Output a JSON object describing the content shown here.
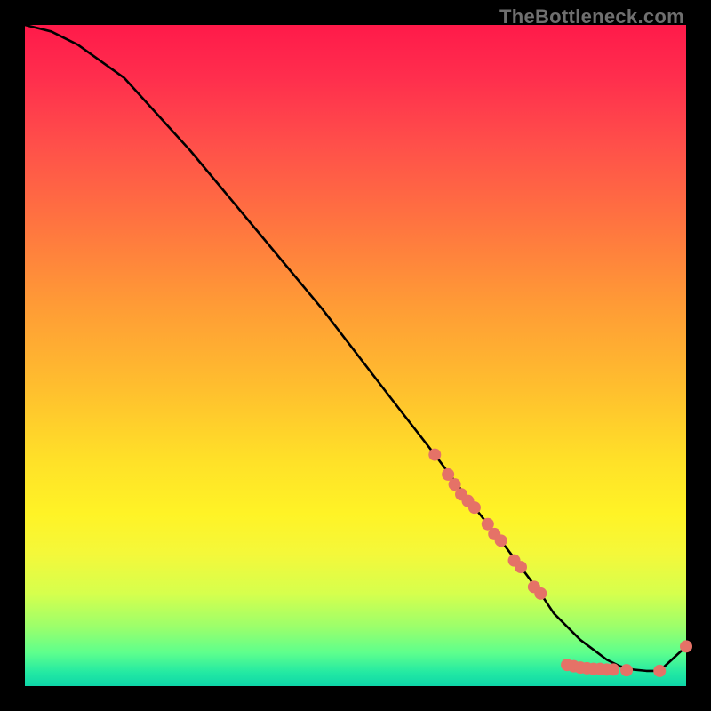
{
  "watermark": "TheBottleneck.com",
  "colors": {
    "background": "#000000",
    "curve": "#000000",
    "marker": "#e57267",
    "watermark": "#6f6f6f"
  },
  "chart_data": {
    "type": "line",
    "title": "",
    "xlabel": "",
    "ylabel": "",
    "xlim": [
      0,
      100
    ],
    "ylim": [
      0,
      100
    ],
    "grid": false,
    "series": [
      {
        "name": "bottleneck-curve",
        "x": [
          0,
          4,
          8,
          15,
          25,
          35,
          45,
          55,
          62,
          68,
          72,
          75,
          78,
          80,
          82,
          84,
          86,
          88,
          90,
          92,
          94,
          96,
          100
        ],
        "y": [
          100,
          99,
          97,
          92,
          81,
          69,
          57,
          44,
          35,
          27,
          22,
          18,
          14,
          11,
          9,
          7,
          5.5,
          4,
          3,
          2.5,
          2.3,
          2.3,
          6
        ]
      }
    ],
    "markers": {
      "name": "highlighted-points",
      "description": "Salmon dots along the lower portion of the curve and the final upturn point",
      "points": [
        {
          "x": 62,
          "y": 35
        },
        {
          "x": 64,
          "y": 32
        },
        {
          "x": 65,
          "y": 30.5
        },
        {
          "x": 66,
          "y": 29
        },
        {
          "x": 67,
          "y": 28
        },
        {
          "x": 68,
          "y": 27
        },
        {
          "x": 70,
          "y": 24.5
        },
        {
          "x": 71,
          "y": 23
        },
        {
          "x": 72,
          "y": 22
        },
        {
          "x": 74,
          "y": 19
        },
        {
          "x": 75,
          "y": 18
        },
        {
          "x": 77,
          "y": 15
        },
        {
          "x": 78,
          "y": 14
        },
        {
          "x": 82,
          "y": 3.2
        },
        {
          "x": 83,
          "y": 3.0
        },
        {
          "x": 84,
          "y": 2.8
        },
        {
          "x": 85,
          "y": 2.7
        },
        {
          "x": 86,
          "y": 2.6
        },
        {
          "x": 87,
          "y": 2.6
        },
        {
          "x": 88,
          "y": 2.5
        },
        {
          "x": 89,
          "y": 2.5
        },
        {
          "x": 91,
          "y": 2.4
        },
        {
          "x": 96,
          "y": 2.3
        },
        {
          "x": 100,
          "y": 6
        }
      ]
    }
  }
}
